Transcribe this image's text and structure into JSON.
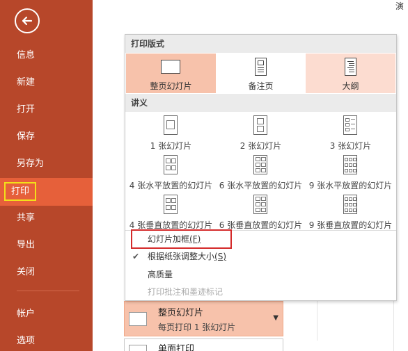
{
  "sidebar": {
    "items": [
      {
        "label": "信息"
      },
      {
        "label": "新建"
      },
      {
        "label": "打开"
      },
      {
        "label": "保存"
      },
      {
        "label": "另存为"
      },
      {
        "label": "打印"
      },
      {
        "label": "共享"
      },
      {
        "label": "导出"
      },
      {
        "label": "关闭"
      },
      {
        "label": "帐户"
      },
      {
        "label": "选项"
      }
    ]
  },
  "header": {
    "top_right": "演"
  },
  "popup": {
    "layout_section": "打印版式",
    "layouts": [
      {
        "label": "整页幻灯片"
      },
      {
        "label": "备注页"
      },
      {
        "label": "大纲"
      }
    ],
    "handout_section": "讲义",
    "handouts": [
      {
        "label": "1 张幻灯片"
      },
      {
        "label": "2 张幻灯片"
      },
      {
        "label": "3 张幻灯片"
      },
      {
        "label": "4 张水平放置的幻灯片"
      },
      {
        "label": "6 张水平放置的幻灯片"
      },
      {
        "label": "9 张水平放置的幻灯片"
      },
      {
        "label": "4 张垂直放置的幻灯片"
      },
      {
        "label": "6 张垂直放置的幻灯片"
      },
      {
        "label": "9 张垂直放置的幻灯片"
      }
    ],
    "options": {
      "frame_slides": "幻灯片加框",
      "frame_slides_key": "(F)",
      "scale_to_fit": "根据纸张调整大小",
      "scale_to_fit_key": "(S)",
      "high_quality": "高质量",
      "print_comments": "打印批注和墨迹标记"
    }
  },
  "settings": {
    "layout_main": "整页幻灯片",
    "layout_sub": "每页打印 1 张幻灯片",
    "sides_main": "单面打印"
  }
}
